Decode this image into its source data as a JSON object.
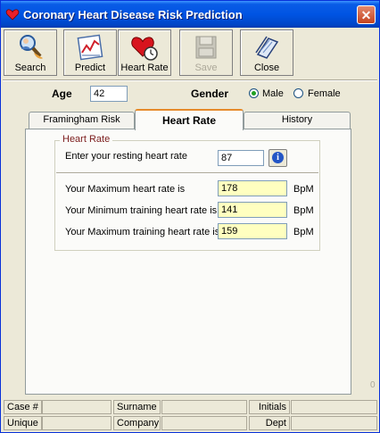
{
  "window": {
    "title": "Coronary Heart Disease Risk Prediction"
  },
  "toolbar": {
    "search": "Search",
    "predict": "Predict",
    "heart_rate": "Heart Rate",
    "save": "Save",
    "close": "Close"
  },
  "patient": {
    "age_label": "Age",
    "age_value": "42",
    "gender_label": "Gender",
    "male": "Male",
    "female": "Female",
    "gender_selected": "Male"
  },
  "tabs": {
    "framingham": "Framingham Risk",
    "heart_rate": "Heart Rate",
    "history": "History"
  },
  "heart_rate_panel": {
    "group_title": "Heart Rate",
    "resting_label": "Enter your resting heart rate",
    "resting_value": "87",
    "max_label": "Your Maximum heart rate is",
    "max_value": "178",
    "min_train_label": "Your Minimum training heart rate is",
    "min_train_value": "141",
    "max_train_label": "Your Maximum training heart rate is",
    "max_train_value": "159",
    "unit": "BpM"
  },
  "stray_text": "0",
  "status": {
    "case": "Case #",
    "surname": "Surname",
    "initials": "Initials",
    "unique": "Unique",
    "company": "Company",
    "dept": "Dept"
  },
  "icons": {
    "title": "heart-icon",
    "search": "magnifier-person-icon",
    "predict": "chart-icon",
    "heart_rate": "heart-clock-icon",
    "save": "disk-icon",
    "close": "close-book-icon",
    "info": "info-icon"
  }
}
